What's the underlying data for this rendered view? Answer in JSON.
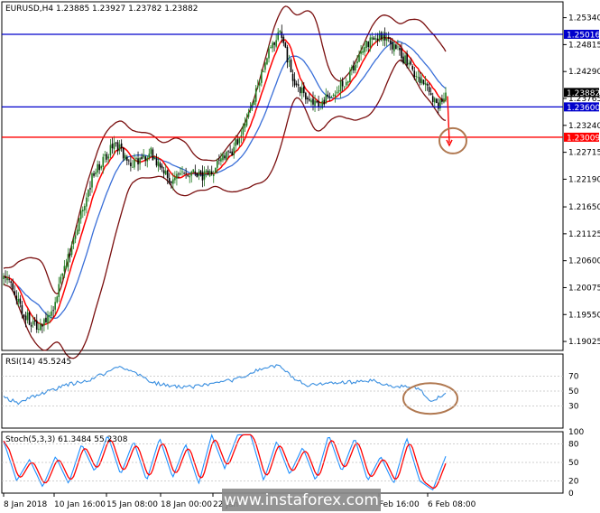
{
  "colors": {
    "background": "#ffffff",
    "frame": "#000000",
    "candle_up": "#1f7a1f",
    "candle_down": "#000000",
    "bollinger": "#7a0f0f",
    "ma_fast": "#ff0000",
    "ma_slow": "#3a6fd8",
    "resistance": "#0000cc",
    "support": "#ff0000",
    "annotation": "#b07850",
    "rsi": "#3a8fe0",
    "stoch_main": "#1e90ff",
    "stoch_signal": "#ff0000",
    "price_tag_blue": "#0000cc",
    "price_tag_red": "#ff0000",
    "price_tag_current": "#000000",
    "watermark_bg": "#888888"
  },
  "chart_data": [
    {
      "type": "candlestick",
      "title": "EURUSD,H4  1.23885 1.23927 1.23782 1.23882",
      "ylim": [
        1.1885,
        1.2565
      ],
      "y_ticks": [
        "1.25340",
        "1.24815",
        "1.24290",
        "1.23765",
        "1.23240",
        "1.22715",
        "1.22190",
        "1.21650",
        "1.21125",
        "1.20600",
        "1.20075",
        "1.19550",
        "1.19025"
      ],
      "x_tick_labels": [
        "8 Jan 2018",
        "10 Jan 16:00",
        "15 Jan 08:00",
        "18 Jan 00:00",
        "22 Jan",
        "Feb 16:00",
        "6 Feb 08:00"
      ],
      "levels": [
        {
          "label": "1.25016",
          "value": 1.25016,
          "color": "#0000cc"
        },
        {
          "label": "1.23600",
          "value": 1.236,
          "color": "#0000cc"
        },
        {
          "label": "1.23009",
          "value": 1.23009,
          "color": "#ff0000"
        }
      ],
      "current_price": {
        "label": "1.23882",
        "value": 1.23882
      },
      "close_path": [
        1.204,
        1.196,
        1.193,
        1.196,
        1.208,
        1.222,
        1.229,
        1.2245,
        1.227,
        1.2215,
        1.223,
        1.2225,
        1.2255,
        1.227,
        1.2355,
        1.247,
        1.25,
        1.241,
        1.238,
        1.236,
        1.2385,
        1.241,
        1.248,
        1.25,
        1.247,
        1.243,
        1.24,
        1.236,
        1.2385
      ],
      "close_path_bars": [
        0,
        10,
        18,
        26,
        36,
        48,
        60,
        70,
        80,
        90,
        100,
        110,
        118,
        124,
        134,
        144,
        150,
        158,
        164,
        170,
        178,
        186,
        196,
        206,
        214,
        222,
        230,
        236,
        240
      ],
      "bar_count": 241
    },
    {
      "type": "line",
      "title": "RSI(14) 45.5245",
      "ylim": [
        0,
        100
      ],
      "y_ticks": [
        "70",
        "50",
        "30"
      ],
      "values": [
        42,
        34,
        46,
        58,
        66,
        76,
        82,
        78,
        62,
        56,
        56,
        60,
        66,
        74,
        82,
        84,
        70,
        58,
        60,
        62,
        64,
        56,
        56,
        54,
        34,
        42,
        46
      ],
      "value_bars": [
        0,
        8,
        20,
        34,
        48,
        56,
        62,
        70,
        80,
        92,
        104,
        116,
        126,
        134,
        142,
        150,
        156,
        164,
        176,
        188,
        200,
        210,
        218,
        226,
        232,
        236,
        240
      ]
    },
    {
      "type": "line",
      "title": "Stoch(5,3,3) 61.3484 55.2308",
      "ylim": [
        0,
        100
      ],
      "y_ticks": [
        "100",
        "80",
        "50",
        "20",
        "0"
      ],
      "series": [
        {
          "values": [
            85,
            20,
            55,
            10,
            60,
            15,
            80,
            35,
            95,
            30,
            85,
            20,
            90,
            25,
            80,
            15,
            95,
            40,
            95,
            95,
            20,
            85,
            30,
            75,
            20,
            95,
            35,
            90,
            20,
            60,
            15,
            90,
            20,
            5,
            60
          ]
        }
      ]
    }
  ],
  "annotations": {
    "watermark": "www.instaforex.com"
  }
}
